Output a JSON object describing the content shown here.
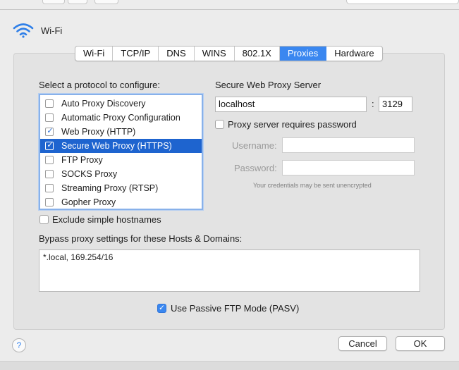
{
  "header": {
    "title": "Wi-Fi",
    "icon": "wifi-icon"
  },
  "tabs": [
    {
      "label": "Wi-Fi",
      "active": false
    },
    {
      "label": "TCP/IP",
      "active": false
    },
    {
      "label": "DNS",
      "active": false
    },
    {
      "label": "WINS",
      "active": false
    },
    {
      "label": "802.1X",
      "active": false
    },
    {
      "label": "Proxies",
      "active": true
    },
    {
      "label": "Hardware",
      "active": false
    }
  ],
  "protocols": {
    "heading": "Select a protocol to configure:",
    "items": [
      {
        "label": "Auto Proxy Discovery",
        "checked": false,
        "selected": false
      },
      {
        "label": "Automatic Proxy Configuration",
        "checked": false,
        "selected": false
      },
      {
        "label": "Web Proxy (HTTP)",
        "checked": true,
        "selected": false
      },
      {
        "label": "Secure Web Proxy (HTTPS)",
        "checked": true,
        "selected": true
      },
      {
        "label": "FTP Proxy",
        "checked": false,
        "selected": false
      },
      {
        "label": "SOCKS Proxy",
        "checked": false,
        "selected": false
      },
      {
        "label": "Streaming Proxy (RTSP)",
        "checked": false,
        "selected": false
      },
      {
        "label": "Gopher Proxy",
        "checked": false,
        "selected": false
      }
    ]
  },
  "exclude_simple": {
    "label": "Exclude simple hostnames",
    "checked": false
  },
  "server": {
    "heading": "Secure Web Proxy Server",
    "host": "localhost",
    "separator": ":",
    "port": "3129",
    "requires_password": {
      "label": "Proxy server requires password",
      "checked": false
    },
    "username_label": "Username:",
    "password_label": "Password:",
    "username_value": "",
    "password_value": "",
    "note": "Your credentials may be sent unencrypted"
  },
  "bypass": {
    "label": "Bypass proxy settings for these Hosts & Domains:",
    "value": "*.local, 169.254/16"
  },
  "passive_ftp": {
    "label": "Use Passive FTP Mode (PASV)",
    "checked": true
  },
  "footer": {
    "help": "?",
    "cancel": "Cancel",
    "ok": "OK"
  },
  "colors": {
    "accent": "#3a87f0",
    "selection": "#1e64cf"
  }
}
